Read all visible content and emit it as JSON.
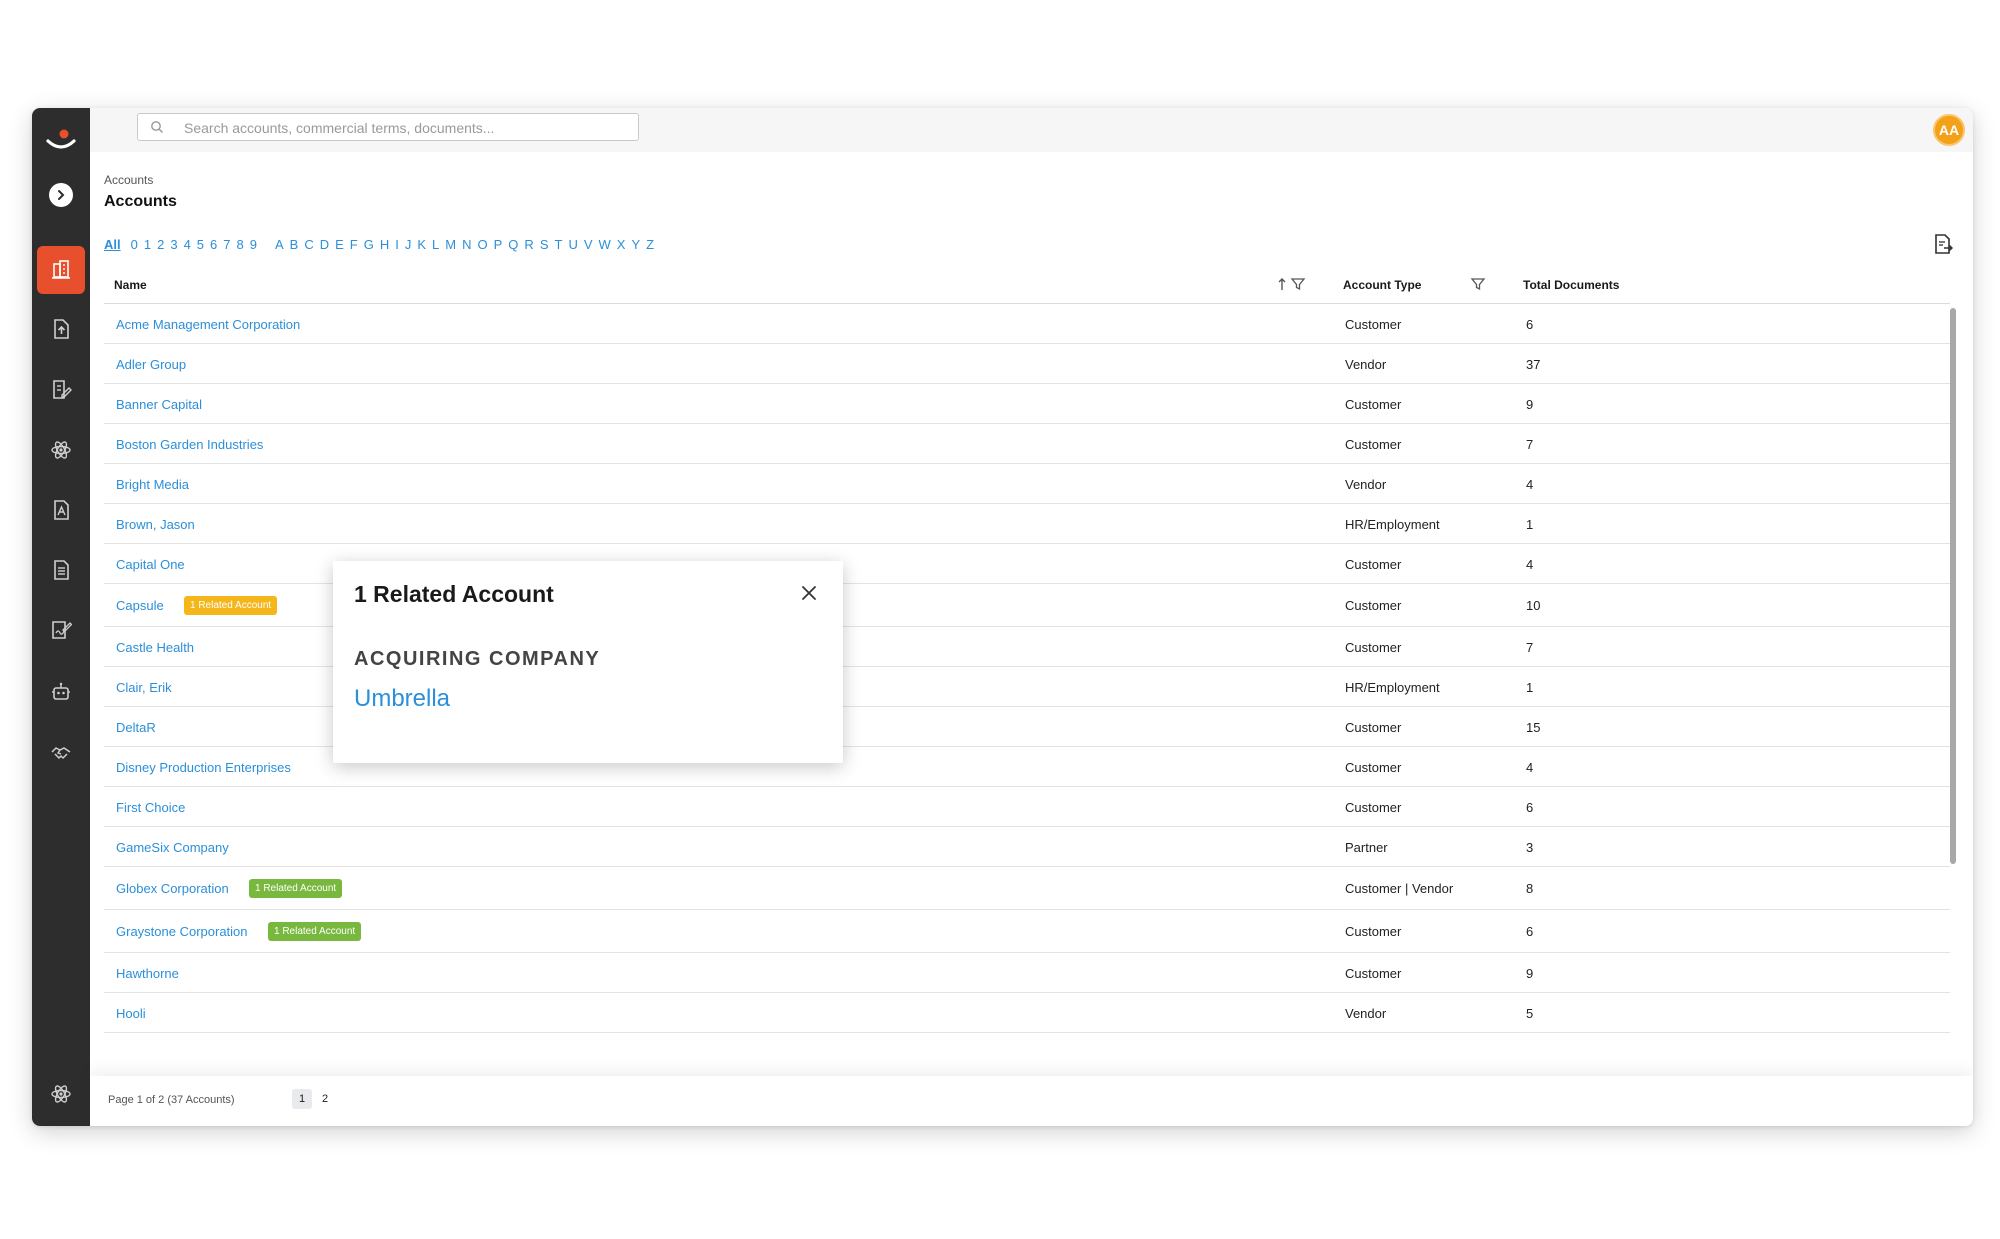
{
  "search": {
    "placeholder": "Search accounts, commercial terms, documents..."
  },
  "user": {
    "initials": "AA"
  },
  "breadcrumb": "Accounts",
  "page_title": "Accounts",
  "alpha_filter": {
    "all": "All",
    "digits": [
      "0",
      "1",
      "2",
      "3",
      "4",
      "5",
      "6",
      "7",
      "8",
      "9"
    ],
    "letters": [
      "A",
      "B",
      "C",
      "D",
      "E",
      "F",
      "G",
      "H",
      "I",
      "J",
      "K",
      "L",
      "M",
      "N",
      "O",
      "P",
      "Q",
      "R",
      "S",
      "T",
      "U",
      "V",
      "W",
      "X",
      "Y",
      "Z"
    ]
  },
  "columns": {
    "name": "Name",
    "type": "Account Type",
    "docs": "Total Documents"
  },
  "rows": [
    {
      "name": "Acme Management Corporation",
      "type": "Customer",
      "docs": "6"
    },
    {
      "name": "Adler Group",
      "type": "Vendor",
      "docs": "37"
    },
    {
      "name": "Banner Capital",
      "type": "Customer",
      "docs": "9"
    },
    {
      "name": "Boston Garden Industries",
      "type": "Customer",
      "docs": "7"
    },
    {
      "name": "Bright Media",
      "type": "Vendor",
      "docs": "4"
    },
    {
      "name": "Brown, Jason",
      "type": "HR/Employment",
      "docs": "1"
    },
    {
      "name": "Capital One",
      "type": "Customer",
      "docs": "4"
    },
    {
      "name": "Capsule",
      "type": "Customer",
      "docs": "10",
      "badge": "1 Related Account",
      "badge_color": "#f4b61a"
    },
    {
      "name": "Castle Health",
      "type": "Customer",
      "docs": "7"
    },
    {
      "name": "Clair, Erik",
      "type": "HR/Employment",
      "docs": "1"
    },
    {
      "name": "DeltaR",
      "type": "Customer",
      "docs": "15"
    },
    {
      "name": "Disney Production Enterprises",
      "type": "Customer",
      "docs": "4"
    },
    {
      "name": "First Choice",
      "type": "Customer",
      "docs": "6"
    },
    {
      "name": "GameSix Company",
      "type": "Partner",
      "docs": "3"
    },
    {
      "name": "Globex Corporation",
      "type": "Customer | Vendor",
      "docs": "8",
      "badge": "1 Related Account",
      "badge_color": "#78b83e"
    },
    {
      "name": "Graystone Corporation",
      "type": "Customer",
      "docs": "6",
      "badge": "1 Related Account",
      "badge_color": "#78b83e"
    },
    {
      "name": "Hawthorne",
      "type": "Customer",
      "docs": "9"
    },
    {
      "name": "Hooli",
      "type": "Vendor",
      "docs": "5"
    }
  ],
  "pagination": {
    "info": "Page 1 of 2 (37 Accounts)",
    "pages": [
      "1",
      "2"
    ],
    "current": "1"
  },
  "popup": {
    "title": "1 Related Account",
    "section": "ACQUIRING COMPANY",
    "link": "Umbrella"
  },
  "help": {
    "label": "?"
  },
  "colors": {
    "accent": "#e8502d",
    "link": "#2b8fd9",
    "sidebar": "#2d2d2d",
    "avatar": "#f4a11a"
  },
  "icons": {
    "sidebar": [
      "accounts-icon",
      "upload-document-icon",
      "edit-document-icon",
      "atom-icon",
      "contract-icon",
      "report-icon",
      "signature-icon",
      "robot-icon",
      "handshake-icon",
      "settings-icon"
    ]
  }
}
